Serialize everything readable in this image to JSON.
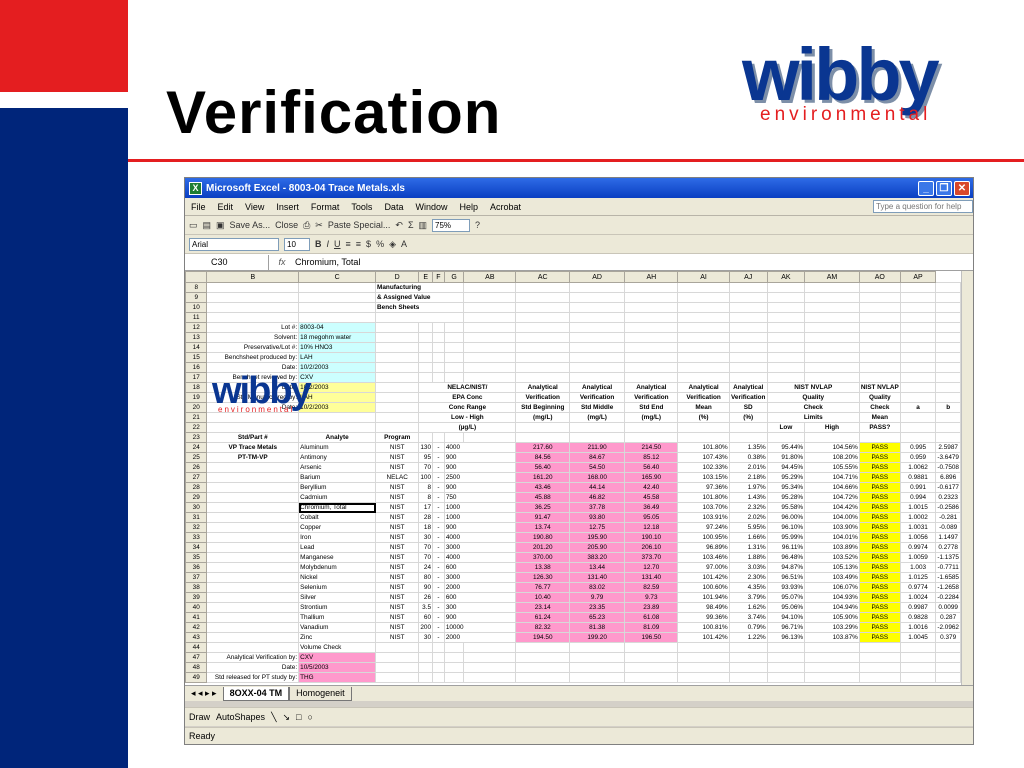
{
  "slide": {
    "title": "Verification",
    "logo_word": "wibby",
    "logo_sub": "environmental",
    "accent_red": "#e41e20",
    "brand_blue": "#00257a"
  },
  "window": {
    "title": "Microsoft Excel - 8003-04 Trace Metals.xls",
    "buttons": [
      "_",
      "❐",
      "✕"
    ]
  },
  "menu": {
    "items": [
      "File",
      "Edit",
      "View",
      "Insert",
      "Format",
      "Tools",
      "Data",
      "Window",
      "Help",
      "Acrobat"
    ],
    "ask_placeholder": "Type a question for help"
  },
  "toolbar": {
    "save_as": "Save As...",
    "close": "Close",
    "paste_special": "Paste Special...",
    "zoom": "75%",
    "font": "Arial",
    "size": "10"
  },
  "formula_bar": {
    "cell_ref": "C30",
    "fx": "fx",
    "content": "Chromium, Total"
  },
  "sheet": {
    "columns": [
      "B",
      "C",
      "D",
      "E",
      "F",
      "G",
      "AB",
      "AC",
      "AD",
      "AH",
      "AI",
      "AJ",
      "AK",
      "AM",
      "AO",
      "AP"
    ],
    "header_text": {
      "title1": "Manufacturing",
      "title2": "& Assigned Value",
      "title3": "Bench Sheets"
    },
    "info": [
      {
        "row": "12",
        "label": "Lot #:",
        "value": "8003-04"
      },
      {
        "row": "13",
        "label": "Solvent:",
        "value": "18 megohm water"
      },
      {
        "row": "14",
        "label": "Preservative/Lot #:",
        "value": "10% HNO3"
      },
      {
        "row": "15",
        "label": "Benchsheet produced by:",
        "value": "LAH"
      },
      {
        "row": "16",
        "label": "Date:",
        "value": "10/2/2003"
      },
      {
        "row": "17",
        "label": "Bensheet reviewed by:",
        "value": "CXV"
      },
      {
        "row": "18",
        "label": "Date:",
        "value": "10/2/2003"
      },
      {
        "row": "19",
        "label": "Std Manufactured by:",
        "value": "LAH"
      },
      {
        "row": "20",
        "label": "Date:",
        "value": "10/2/2003"
      }
    ],
    "hdr": {
      "nelac": [
        "NELAC/NIST/",
        "EPA Conc",
        "Conc Range",
        "Low  -  High",
        "(µg/L)"
      ],
      "ab": [
        "Analytical",
        "Verification",
        "Std Beginning",
        "(mg/L)"
      ],
      "ac": [
        "Analytical",
        "Verification",
        "Std Middle",
        "(mg/L)"
      ],
      "ad": [
        "Analytical",
        "Verification",
        "Std End",
        "(mg/L)"
      ],
      "ah": [
        "Analytical",
        "Verification",
        "Mean",
        "(%)"
      ],
      "ai": [
        "Analytical",
        "Verification",
        "SD",
        "(%)"
      ],
      "ajak": [
        "NIST NVLAP",
        "Quality",
        "Check",
        "Limits"
      ],
      "low": "Low",
      "high": "High",
      "am": [
        "NIST NVLAP",
        "Quality",
        "Check",
        "Mean",
        "PASS?"
      ],
      "ao": "a",
      "ap": "b",
      "std": "Std/Part #",
      "analyte": "Analyte",
      "program": "Program"
    },
    "std_part": [
      "VP Trace Metals",
      "PT-TM-VP"
    ],
    "rows": [
      {
        "n": "24",
        "analyte": "Aluminum",
        "prog": "NIST",
        "low": "130",
        "high": "4000",
        "ab": "217.60",
        "ac": "211.90",
        "ad": "214.50",
        "ah": "101.80%",
        "ai": "1.35%",
        "aj": "95.44%",
        "ak": "104.56%",
        "am": "PASS",
        "ao": "0.995",
        "ap": "2.5987"
      },
      {
        "n": "25",
        "analyte": "Antimony",
        "prog": "NIST",
        "low": "95",
        "high": "900",
        "ab": "84.56",
        "ac": "84.67",
        "ad": "85.12",
        "ah": "107.43%",
        "ai": "0.38%",
        "aj": "91.80%",
        "ak": "108.20%",
        "am": "PASS",
        "ao": "0.959",
        "ap": "-3.6479"
      },
      {
        "n": "26",
        "analyte": "Arsenic",
        "prog": "NIST",
        "low": "70",
        "high": "900",
        "ab": "56.40",
        "ac": "54.50",
        "ad": "56.40",
        "ah": "102.33%",
        "ai": "2.01%",
        "aj": "94.45%",
        "ak": "105.55%",
        "am": "PASS",
        "ao": "1.0062",
        "ap": "-0.7508"
      },
      {
        "n": "27",
        "analyte": "Barium",
        "prog": "NELAC",
        "low": "100",
        "high": "2500",
        "ab": "161.20",
        "ac": "168.00",
        "ad": "165.90",
        "ah": "103.15%",
        "ai": "2.18%",
        "aj": "95.29%",
        "ak": "104.71%",
        "am": "PASS",
        "ao": "0.9881",
        "ap": "6.896"
      },
      {
        "n": "28",
        "analyte": "Beryllium",
        "prog": "NIST",
        "low": "8",
        "high": "900",
        "ab": "43.46",
        "ac": "44.14",
        "ad": "42.40",
        "ah": "97.36%",
        "ai": "1.97%",
        "aj": "95.34%",
        "ak": "104.66%",
        "am": "PASS",
        "ao": "0.991",
        "ap": "-0.6177"
      },
      {
        "n": "29",
        "analyte": "Cadmium",
        "prog": "NIST",
        "low": "8",
        "high": "750",
        "ab": "45.88",
        "ac": "46.82",
        "ad": "45.58",
        "ah": "101.80%",
        "ai": "1.43%",
        "aj": "95.28%",
        "ak": "104.72%",
        "am": "PASS",
        "ao": "0.994",
        "ap": "0.2323"
      },
      {
        "n": "30",
        "analyte": "Chromium, Total",
        "prog": "NIST",
        "low": "17",
        "high": "1000",
        "ab": "36.25",
        "ac": "37.78",
        "ad": "36.49",
        "ah": "103.70%",
        "ai": "2.32%",
        "aj": "95.58%",
        "ak": "104.42%",
        "am": "PASS",
        "ao": "1.0015",
        "ap": "-0.2586"
      },
      {
        "n": "31",
        "analyte": "Cobalt",
        "prog": "NIST",
        "low": "28",
        "high": "1000",
        "ab": "91.47",
        "ac": "93.80",
        "ad": "95.05",
        "ah": "103.91%",
        "ai": "2.02%",
        "aj": "96.00%",
        "ak": "104.00%",
        "am": "PASS",
        "ao": "1.0002",
        "ap": "-0.281"
      },
      {
        "n": "32",
        "analyte": "Copper",
        "prog": "NIST",
        "low": "18",
        "high": "900",
        "ab": "13.74",
        "ac": "12.75",
        "ad": "12.18",
        "ah": "97.24%",
        "ai": "5.95%",
        "aj": "96.10%",
        "ak": "103.90%",
        "am": "PASS",
        "ao": "1.0031",
        "ap": "-0.089"
      },
      {
        "n": "33",
        "analyte": "Iron",
        "prog": "NIST",
        "low": "30",
        "high": "4000",
        "ab": "190.80",
        "ac": "195.90",
        "ad": "190.10",
        "ah": "100.95%",
        "ai": "1.66%",
        "aj": "95.99%",
        "ak": "104.01%",
        "am": "PASS",
        "ao": "1.0056",
        "ap": "1.1497"
      },
      {
        "n": "34",
        "analyte": "Lead",
        "prog": "NIST",
        "low": "70",
        "high": "3000",
        "ab": "201.20",
        "ac": "205.90",
        "ad": "206.10",
        "ah": "96.89%",
        "ai": "1.31%",
        "aj": "96.11%",
        "ak": "103.89%",
        "am": "PASS",
        "ao": "0.9974",
        "ap": "0.2778"
      },
      {
        "n": "35",
        "analyte": "Manganese",
        "prog": "NIST",
        "low": "70",
        "high": "4000",
        "ab": "370.00",
        "ac": "383.20",
        "ad": "373.70",
        "ah": "103.46%",
        "ai": "1.88%",
        "aj": "96.48%",
        "ak": "103.52%",
        "am": "PASS",
        "ao": "1.0059",
        "ap": "-1.1375"
      },
      {
        "n": "36",
        "analyte": "Molybdenum",
        "prog": "NIST",
        "low": "24",
        "high": "600",
        "ab": "13.38",
        "ac": "13.44",
        "ad": "12.70",
        "ah": "97.00%",
        "ai": "3.03%",
        "aj": "94.87%",
        "ak": "105.13%",
        "am": "PASS",
        "ao": "1.003",
        "ap": "-0.7711"
      },
      {
        "n": "37",
        "analyte": "Nickel",
        "prog": "NIST",
        "low": "80",
        "high": "3000",
        "ab": "126.30",
        "ac": "131.40",
        "ad": "131.40",
        "ah": "101.42%",
        "ai": "2.30%",
        "aj": "96.51%",
        "ak": "103.49%",
        "am": "PASS",
        "ao": "1.0125",
        "ap": "-1.6585"
      },
      {
        "n": "38",
        "analyte": "Selenium",
        "prog": "NIST",
        "low": "90",
        "high": "2000",
        "ab": "76.77",
        "ac": "83.02",
        "ad": "82.59",
        "ah": "100.60%",
        "ai": "4.35%",
        "aj": "93.93%",
        "ak": "106.07%",
        "am": "PASS",
        "ao": "0.9774",
        "ap": "-1.2658"
      },
      {
        "n": "39",
        "analyte": "Silver",
        "prog": "NIST",
        "low": "26",
        "high": "600",
        "ab": "10.40",
        "ac": "9.79",
        "ad": "9.73",
        "ah": "101.94%",
        "ai": "3.79%",
        "aj": "95.07%",
        "ak": "104.93%",
        "am": "PASS",
        "ao": "1.0024",
        "ap": "-0.2284"
      },
      {
        "n": "40",
        "analyte": "Strontium",
        "prog": "NIST",
        "low": "3.5",
        "high": "300",
        "ab": "23.14",
        "ac": "23.35",
        "ad": "23.89",
        "ah": "98.49%",
        "ai": "1.62%",
        "aj": "95.06%",
        "ak": "104.94%",
        "am": "PASS",
        "ao": "0.9987",
        "ap": "0.0099"
      },
      {
        "n": "41",
        "analyte": "Thallium",
        "prog": "NIST",
        "low": "60",
        "high": "900",
        "ab": "61.24",
        "ac": "65.23",
        "ad": "61.08",
        "ah": "99.36%",
        "ai": "3.74%",
        "aj": "94.10%",
        "ak": "105.90%",
        "am": "PASS",
        "ao": "0.9828",
        "ap": "0.287"
      },
      {
        "n": "42",
        "analyte": "Vanadium",
        "prog": "NIST",
        "low": "200",
        "high": "10000",
        "ab": "82.32",
        "ac": "81.38",
        "ad": "81.09",
        "ah": "100.81%",
        "ai": "0.79%",
        "aj": "96.71%",
        "ak": "103.29%",
        "am": "PASS",
        "ao": "1.0016",
        "ap": "-2.0962"
      },
      {
        "n": "43",
        "analyte": "Zinc",
        "prog": "NIST",
        "low": "30",
        "high": "2000",
        "ab": "194.50",
        "ac": "199.20",
        "ad": "196.50",
        "ah": "101.42%",
        "ai": "1.22%",
        "aj": "96.13%",
        "ak": "103.87%",
        "am": "PASS",
        "ao": "1.0045",
        "ap": "0.379"
      }
    ],
    "volume_check": "Volume Check",
    "footer": [
      {
        "row": "47",
        "label": "Analytical Verification by:",
        "value": "CXV"
      },
      {
        "row": "48",
        "label": "Date:",
        "value": "10/5/2003"
      },
      {
        "row": "49",
        "label": "Std released for PT study by:",
        "value": "THG"
      }
    ]
  },
  "tabs": [
    "8OXX-04 TM",
    "Homogeneit"
  ],
  "draw": {
    "draw": "Draw",
    "autoshapes": "AutoShapes"
  },
  "status": "Ready"
}
